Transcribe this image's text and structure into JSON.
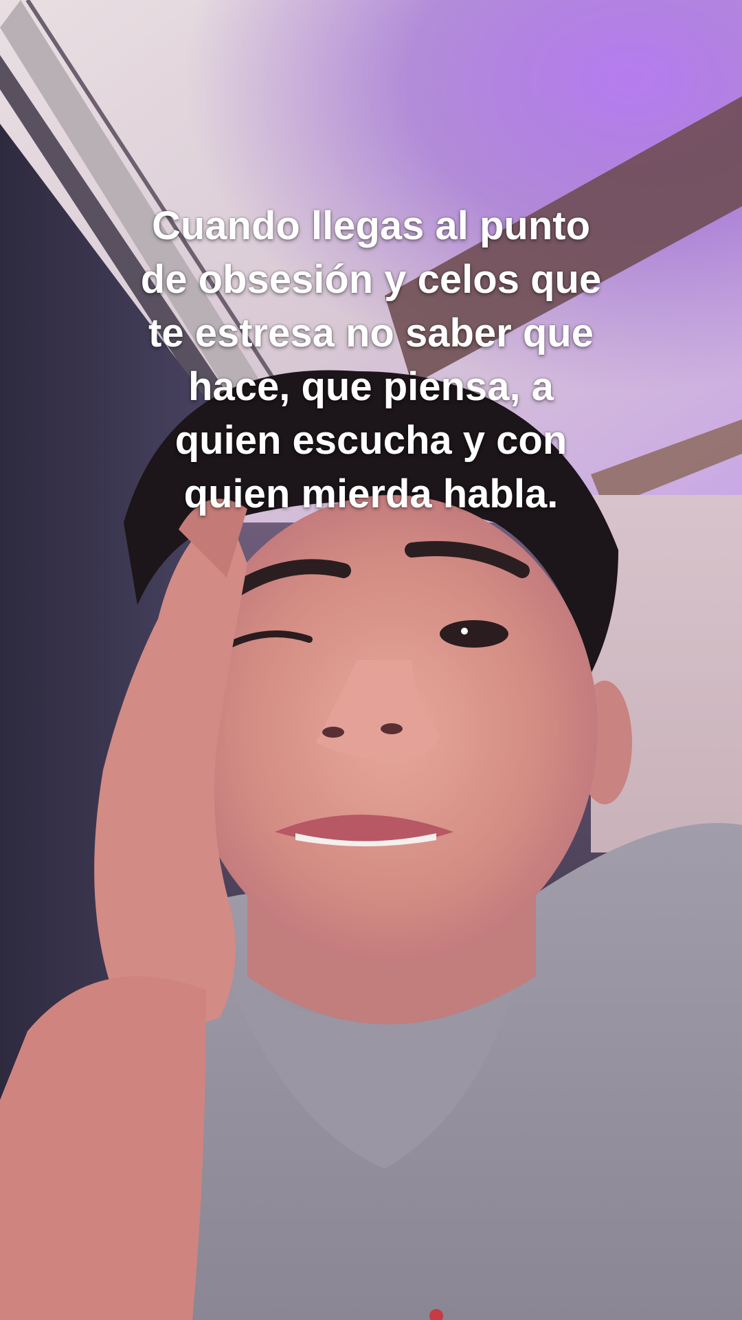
{
  "caption": {
    "lines": [
      "Cuando llegas al punto",
      "de obsesión y celos que",
      "te estresa no saber que",
      "hace, que piensa, a",
      "quien escucha y con",
      "quien mierda habla."
    ]
  },
  "colors": {
    "ceiling": "#e8dde3",
    "purple_light": "#b07ce0",
    "wall_dark": "#3c3550",
    "skin": "#d89488",
    "hair": "#1a1418",
    "shirt": "#8f8c98"
  }
}
